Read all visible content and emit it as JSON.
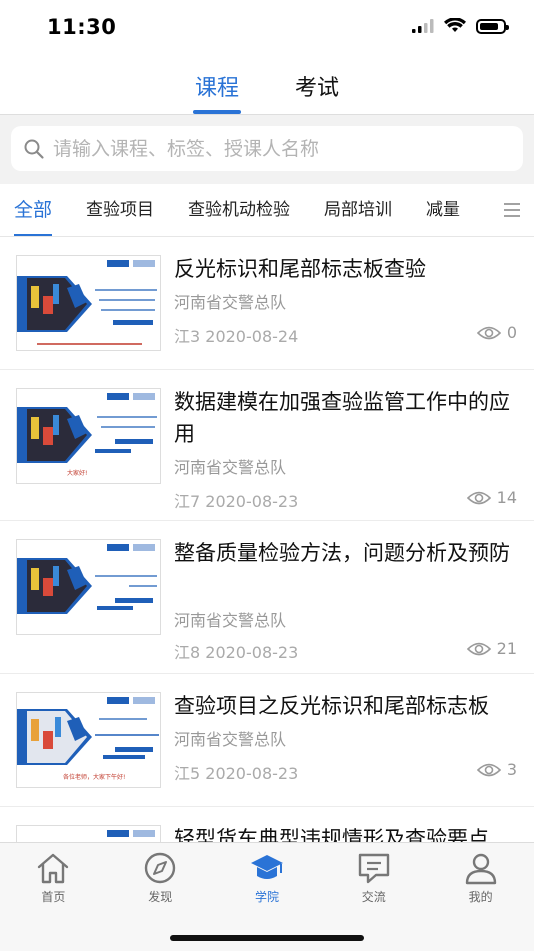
{
  "status": {
    "time": "11:30"
  },
  "top_tabs": [
    {
      "label": "课程",
      "active": true
    },
    {
      "label": "考试",
      "active": false
    }
  ],
  "search": {
    "placeholder": "请输入课程、标签、授课人名称"
  },
  "categories": [
    "全部",
    "查验项目",
    "查验机动检验",
    "局部培训",
    "减量"
  ],
  "courses": [
    {
      "title": "反光标识和尾部标志板查验",
      "org": "河南省交警总队",
      "meta": "江3 2020-08-24",
      "views": "0",
      "thumb_caption": "查验重卡车辆典型违规情形及查验要点",
      "thumb_footer": "查验重点查验要点关注车辆查验的关键"
    },
    {
      "title": "数据建模在加强查验监管工作中的应用",
      "org": "河南省交警总队",
      "meta": "江7 2020-08-23",
      "views": "14",
      "thumb_caption": "重型车辆典型违规情形查验要点",
      "thumb_footer": "大家好!"
    },
    {
      "title": "整备质量检验方法，问题分析及预防",
      "org": "河南省交警总队",
      "meta": "江8 2020-08-23",
      "views": "21",
      "thumb_caption": "轻型货车典型违规情形及查验要点",
      "thumb_footer": ""
    },
    {
      "title": "查验项目之反光标识和尾部标志板",
      "org": "河南省交警总队",
      "meta": "江5 2020-08-23",
      "views": "3",
      "thumb_caption": "反光标识和尾部标志板",
      "thumb_footer": "各位老师，大家下午好!"
    },
    {
      "title": "轻型货车典型违规情形及查验要点",
      "org": "",
      "meta": "",
      "views": "",
      "thumb_caption": "",
      "thumb_footer": ""
    }
  ],
  "tab_bar": [
    {
      "label": "首页",
      "icon": "home-icon",
      "active": false
    },
    {
      "label": "发现",
      "icon": "compass-icon",
      "active": false
    },
    {
      "label": "学院",
      "icon": "graduation-cap-icon",
      "active": true
    },
    {
      "label": "交流",
      "icon": "chat-icon",
      "active": false
    },
    {
      "label": "我的",
      "icon": "profile-icon",
      "active": false
    }
  ],
  "colors": {
    "accent": "#2a73d6",
    "thumb_blue": "#1f5fb8"
  }
}
